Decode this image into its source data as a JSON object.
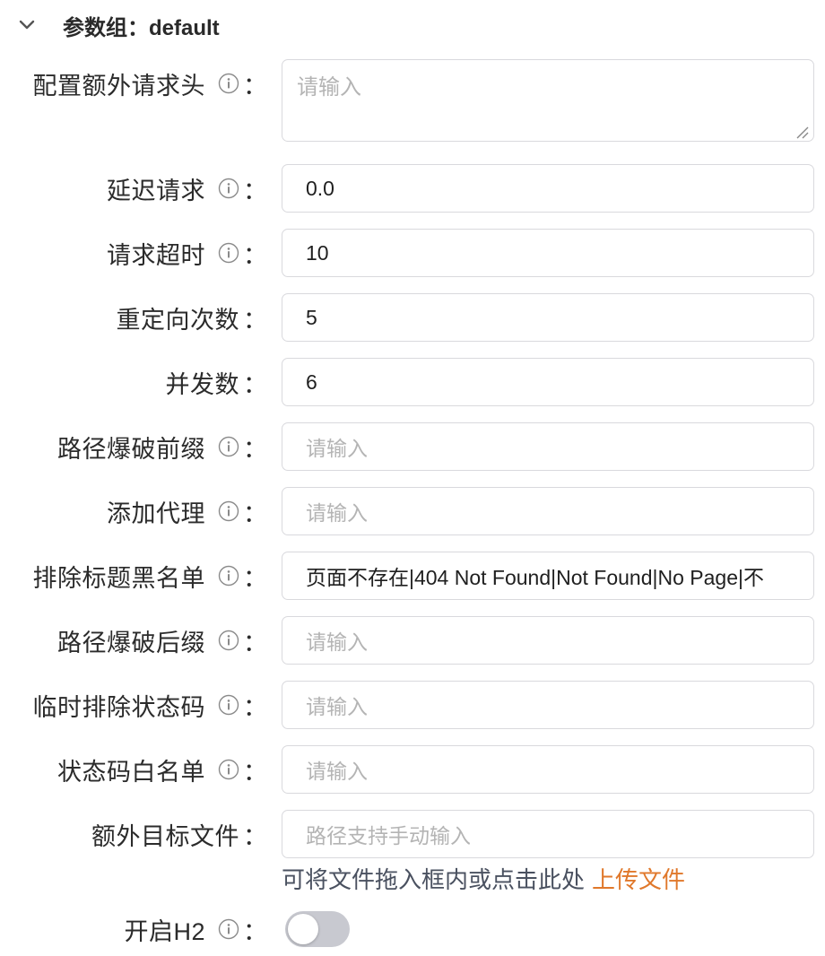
{
  "group": {
    "title": "参数组：default",
    "icon": "chevron-down-icon"
  },
  "fields": [
    {
      "label": "配置额外请求头",
      "placeholder": "请输入",
      "value": ""
    },
    {
      "label": "延迟请求",
      "value": "0.0"
    },
    {
      "label": "请求超时",
      "value": "10"
    },
    {
      "label": "重定向次数",
      "value": "5"
    },
    {
      "label": "并发数",
      "value": "6"
    },
    {
      "label": "路径爆破前缀",
      "placeholder": "请输入",
      "value": ""
    },
    {
      "label": "添加代理",
      "placeholder": "请输入",
      "value": ""
    },
    {
      "label": "排除标题黑名单",
      "value": "页面不存在|404 Not Found|Not Found|No Page|不"
    },
    {
      "label": "路径爆破后缀",
      "placeholder": "请输入",
      "value": ""
    },
    {
      "label": "临时排除状态码",
      "placeholder": "请输入",
      "value": ""
    },
    {
      "label": "状态码白名单",
      "placeholder": "请输入",
      "value": ""
    },
    {
      "label": "额外目标文件",
      "placeholder": "路径支持手动输入",
      "value": ""
    }
  ],
  "upload": {
    "hint": "可将文件拖入框内或点击此处",
    "link": "上传文件"
  },
  "h2": {
    "label": "开启H2",
    "enabled": false
  },
  "colon": "：",
  "colors": {
    "accent": "#e0782b",
    "toggle_off": "#c8c9d0",
    "border": "#d9d9dd"
  }
}
